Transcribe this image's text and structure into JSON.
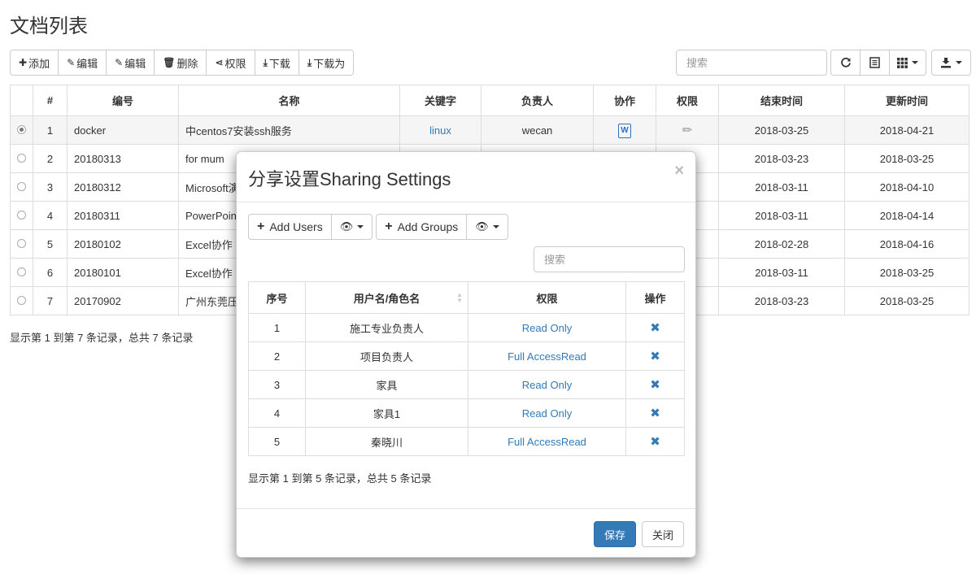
{
  "page": {
    "title": "文档列表"
  },
  "toolbar": {
    "add": "添加",
    "edit1": "编辑",
    "edit2": "编辑",
    "delete": "删除",
    "permission": "权限",
    "download": "下载",
    "download_as": "下载为"
  },
  "search": {
    "placeholder": "搜索"
  },
  "table": {
    "headers": [
      "",
      "#",
      "编号",
      "名称",
      "关键字",
      "负责人",
      "协作",
      "权限",
      "结束时间",
      "更新时间"
    ],
    "rows": [
      {
        "idx": "1",
        "code": "docker",
        "name": "中centos7安装ssh服务",
        "keyword": "linux",
        "owner": "wecan",
        "end": "2018-03-25",
        "updated": "2018-04-21"
      },
      {
        "idx": "2",
        "code": "20180313",
        "name": "for mum",
        "end": "2018-03-23",
        "updated": "2018-03-25"
      },
      {
        "idx": "3",
        "code": "20180312",
        "name": "Microsoft演",
        "end": "2018-03-11",
        "updated": "2018-04-10"
      },
      {
        "idx": "4",
        "code": "20180311",
        "name": "PowerPoin",
        "end": "2018-03-11",
        "updated": "2018-04-14"
      },
      {
        "idx": "5",
        "code": "20180102",
        "name": "Excel协作",
        "end": "2018-02-28",
        "updated": "2018-04-16"
      },
      {
        "idx": "6",
        "code": "20180101",
        "name": "Excel协作",
        "end": "2018-03-11",
        "updated": "2018-03-25"
      },
      {
        "idx": "7",
        "code": "20170902",
        "name": "广州东莞压",
        "end": "2018-03-23",
        "updated": "2018-03-25"
      }
    ]
  },
  "footer": {
    "text": "显示第 1 到第 7 条记录，总共 7 条记录"
  },
  "modal": {
    "title": "分享设置Sharing Settings",
    "close_glyph": "×",
    "add_users": "Add Users",
    "add_groups": "Add Groups",
    "search_placeholder": "搜索",
    "headers": [
      "序号",
      "用户名/角色名",
      "权限",
      "操作"
    ],
    "rows": [
      {
        "idx": "1",
        "name": "施工专业负责人",
        "perm": "Read Only"
      },
      {
        "idx": "2",
        "name": "项目负责人",
        "perm": "Full AccessRead"
      },
      {
        "idx": "3",
        "name": "家具",
        "perm": "Read Only"
      },
      {
        "idx": "4",
        "name": "家具1",
        "perm": "Read Only"
      },
      {
        "idx": "5",
        "name": "秦晓川",
        "perm": "Full AccessRead"
      }
    ],
    "footer_text": "显示第 1 到第 5 条记录，总共 5 条记录",
    "save": "保存",
    "close": "关闭"
  },
  "colors": {
    "primary": "#337ab7",
    "border": "#dddddd"
  },
  "icons": {
    "toolbar": [
      "plus-icon",
      "edit-icon",
      "edit-icon",
      "trash-icon",
      "share-icon",
      "download-icon",
      "download-icon"
    ],
    "right": [
      "refresh-icon",
      "list-icon",
      "columns-icon",
      "export-icon"
    ]
  }
}
